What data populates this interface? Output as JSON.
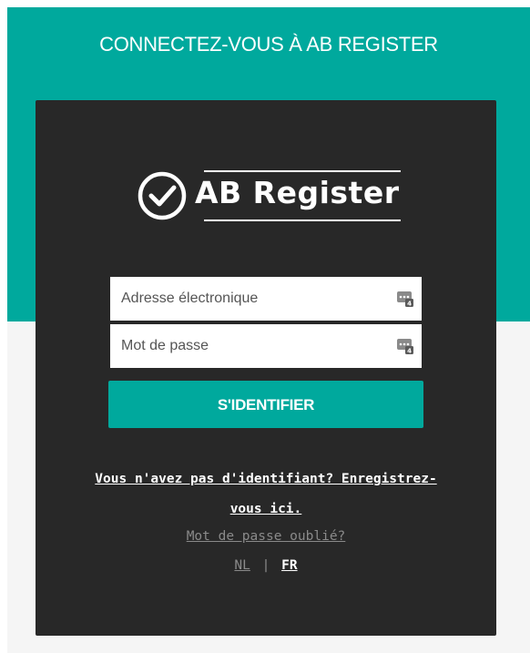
{
  "header": {
    "title": "CONNECTEZ-VOUS À AB REGISTER"
  },
  "logo": {
    "text": "AB Register",
    "icon": "check-circle-icon"
  },
  "form": {
    "email_placeholder": "Adresse électronique",
    "email_value": "",
    "password_placeholder": "Mot de passe",
    "password_value": "",
    "field_icon": "password-manager-key-icon",
    "submit_label": "S'IDENTIFIER"
  },
  "links": {
    "register_line1": "Vous n'avez pas d'identifiant? Enregistrez-",
    "register_line2": "vous ici.",
    "forgot_password": "Mot de passe oublié?",
    "lang_nl": "NL",
    "lang_separator": "|",
    "lang_fr": "FR"
  },
  "colors": {
    "accent": "#00a99d",
    "card": "#282828",
    "background": "#f5f5f5"
  }
}
